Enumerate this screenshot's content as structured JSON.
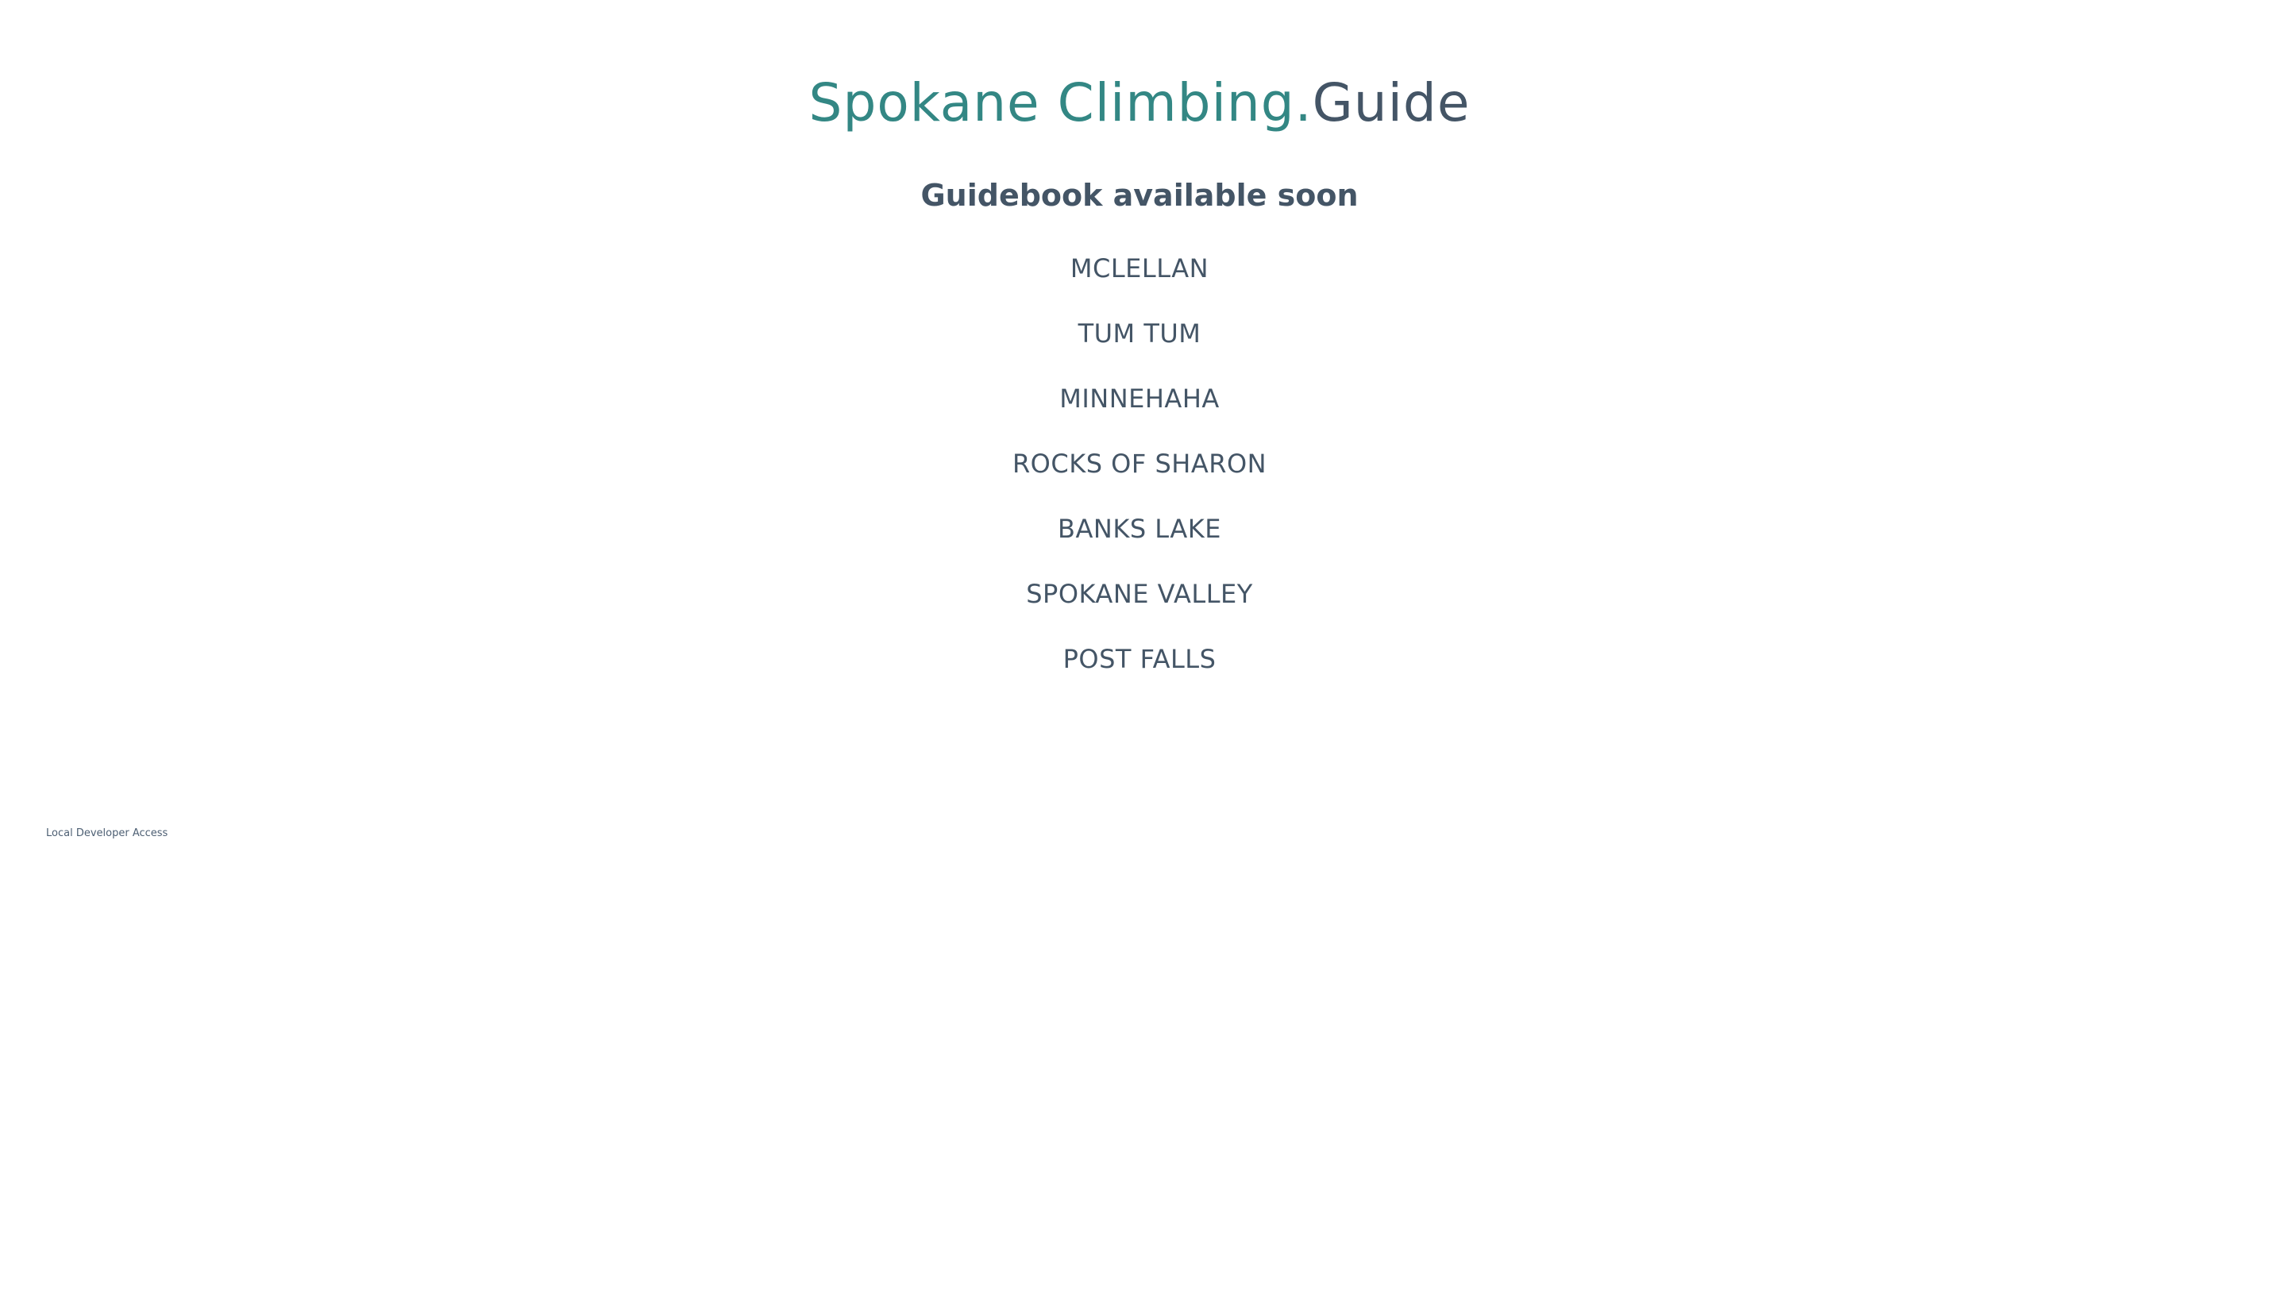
{
  "header": {
    "brand_accent": "Spokane Climbing.",
    "brand_dark": "Guide",
    "subtitle": "Guidebook available soon"
  },
  "areas": [
    "MCLELLAN",
    "TUM TUM",
    "MINNEHAHA",
    "ROCKS OF SHARON",
    "BANKS LAKE",
    "SPOKANE VALLEY",
    "POST FALLS"
  ],
  "footer": {
    "dev_link": "Local Developer Access"
  },
  "colors": {
    "accent": "#338784",
    "text": "#445566",
    "background": "#ffffff"
  }
}
